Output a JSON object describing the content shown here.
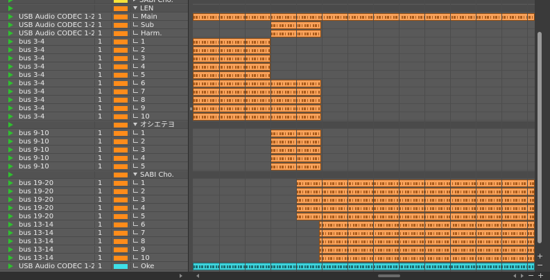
{
  "tracks": [
    {
      "input": "",
      "num": "",
      "color": "#f5e23a",
      "name": "SABI Cho.",
      "kind": "folder-collapsed"
    },
    {
      "input": "",
      "num": "",
      "color": "#ff8c1a",
      "name": "LEN",
      "kind": "folder"
    },
    {
      "input": "USB Audio CODEC  1-2",
      "num": "1",
      "color": "#ff8c1a",
      "name": "Main",
      "kind": "audio"
    },
    {
      "input": "USB Audio CODEC  1-2",
      "num": "1",
      "color": "#ff8c1a",
      "name": "Sub",
      "kind": "audio"
    },
    {
      "input": "USB Audio CODEC  1-2",
      "num": "1",
      "color": "#ff8c1a",
      "name": "Harm.",
      "kind": "audio"
    },
    {
      "input": "bus 3-4",
      "num": "1",
      "color": "#ff8c1a",
      "name": "1",
      "kind": "audio"
    },
    {
      "input": "bus 3-4",
      "num": "1",
      "color": "#ff8c1a",
      "name": "2",
      "kind": "audio"
    },
    {
      "input": "bus 3-4",
      "num": "1",
      "color": "#ff8c1a",
      "name": "3",
      "kind": "audio"
    },
    {
      "input": "bus 3-4",
      "num": "1",
      "color": "#ff8c1a",
      "name": "4",
      "kind": "audio"
    },
    {
      "input": "bus 3-4",
      "num": "1",
      "color": "#ff8c1a",
      "name": "5",
      "kind": "audio"
    },
    {
      "input": "bus 3-4",
      "num": "1",
      "color": "#ff8c1a",
      "name": "6",
      "kind": "audio"
    },
    {
      "input": "bus 3-4",
      "num": "1",
      "color": "#ff8c1a",
      "name": "7",
      "kind": "audio"
    },
    {
      "input": "bus 3-4",
      "num": "1",
      "color": "#ff8c1a",
      "name": "8",
      "kind": "audio"
    },
    {
      "input": "bus 3-4",
      "num": "1",
      "color": "#ff8c1a",
      "name": "9",
      "kind": "audio"
    },
    {
      "input": "bus 3-4",
      "num": "1",
      "color": "#ff8c1a",
      "name": "10",
      "kind": "audio"
    },
    {
      "input": "",
      "num": "",
      "color": "#ff8c1a",
      "name": "オシエテヨ",
      "kind": "folder"
    },
    {
      "input": "bus 9-10",
      "num": "1",
      "color": "#ff8c1a",
      "name": "1",
      "kind": "audio"
    },
    {
      "input": "bus 9-10",
      "num": "1",
      "color": "#ff8c1a",
      "name": "2",
      "kind": "audio"
    },
    {
      "input": "bus 9-10",
      "num": "1",
      "color": "#ff8c1a",
      "name": "3",
      "kind": "audio"
    },
    {
      "input": "bus 9-10",
      "num": "1",
      "color": "#ff8c1a",
      "name": "4",
      "kind": "audio"
    },
    {
      "input": "bus 9-10",
      "num": "1",
      "color": "#ff8c1a",
      "name": "5",
      "kind": "audio"
    },
    {
      "input": "",
      "num": "",
      "color": "#ff8c1a",
      "name": "SABI Cho.",
      "kind": "folder"
    },
    {
      "input": "bus 19-20",
      "num": "1",
      "color": "#ff8c1a",
      "name": "1",
      "kind": "audio"
    },
    {
      "input": "bus 19-20",
      "num": "1",
      "color": "#ff8c1a",
      "name": "2",
      "kind": "audio"
    },
    {
      "input": "bus 19-20",
      "num": "1",
      "color": "#ff8c1a",
      "name": "3",
      "kind": "audio"
    },
    {
      "input": "bus 19-20",
      "num": "1",
      "color": "#ff8c1a",
      "name": "4",
      "kind": "audio"
    },
    {
      "input": "bus 19-20",
      "num": "1",
      "color": "#ff8c1a",
      "name": "5",
      "kind": "audio"
    },
    {
      "input": "bus 13-14",
      "num": "1",
      "color": "#ff8c1a",
      "name": "6",
      "kind": "audio"
    },
    {
      "input": "bus 13-14",
      "num": "1",
      "color": "#ff8c1a",
      "name": "7",
      "kind": "audio"
    },
    {
      "input": "bus 13-14",
      "num": "1",
      "color": "#ff8c1a",
      "name": "8",
      "kind": "audio"
    },
    {
      "input": "bus 13-14",
      "num": "1",
      "color": "#ff8c1a",
      "name": "9",
      "kind": "audio"
    },
    {
      "input": "bus 13-14",
      "num": "1",
      "color": "#ff8c1a",
      "name": "10",
      "kind": "audio"
    },
    {
      "input": "USB Audio CODEC  1-2",
      "num": "1",
      "color": "#3ee0e8",
      "name": "Oke",
      "kind": "instrument"
    }
  ],
  "clips": [
    {
      "track": 2,
      "start": 0.0,
      "end": 1.0,
      "color": "orange"
    },
    {
      "track": 3,
      "start": 0.227,
      "end": 0.376,
      "color": "orange"
    },
    {
      "track": 4,
      "start": 0.227,
      "end": 0.376,
      "color": "orange"
    },
    {
      "track": 5,
      "start": 0.0,
      "end": 0.227,
      "color": "orange"
    },
    {
      "track": 6,
      "start": 0.0,
      "end": 0.227,
      "color": "orange"
    },
    {
      "track": 7,
      "start": 0.0,
      "end": 0.227,
      "color": "orange"
    },
    {
      "track": 8,
      "start": 0.0,
      "end": 0.227,
      "color": "orange"
    },
    {
      "track": 9,
      "start": 0.0,
      "end": 0.227,
      "color": "orange"
    },
    {
      "track": 10,
      "start": 0.0,
      "end": 0.376,
      "color": "orange"
    },
    {
      "track": 11,
      "start": 0.0,
      "end": 0.376,
      "color": "orange"
    },
    {
      "track": 12,
      "start": 0.0,
      "end": 0.376,
      "color": "orange"
    },
    {
      "track": 13,
      "start": 0.0,
      "end": 0.376,
      "color": "orange"
    },
    {
      "track": 14,
      "start": 0.0,
      "end": 0.376,
      "color": "orange"
    },
    {
      "track": 16,
      "start": 0.227,
      "end": 0.376,
      "color": "orange"
    },
    {
      "track": 17,
      "start": 0.227,
      "end": 0.376,
      "color": "orange"
    },
    {
      "track": 18,
      "start": 0.227,
      "end": 0.376,
      "color": "orange"
    },
    {
      "track": 19,
      "start": 0.227,
      "end": 0.376,
      "color": "orange"
    },
    {
      "track": 20,
      "start": 0.227,
      "end": 0.376,
      "color": "orange"
    },
    {
      "track": 22,
      "start": 0.302,
      "end": 1.0,
      "color": "orange"
    },
    {
      "track": 23,
      "start": 0.302,
      "end": 1.0,
      "color": "orange"
    },
    {
      "track": 24,
      "start": 0.302,
      "end": 1.0,
      "color": "orange"
    },
    {
      "track": 25,
      "start": 0.302,
      "end": 1.0,
      "color": "orange"
    },
    {
      "track": 26,
      "start": 0.302,
      "end": 1.0,
      "color": "orange"
    },
    {
      "track": 27,
      "start": 0.37,
      "end": 1.0,
      "color": "orange"
    },
    {
      "track": 28,
      "start": 0.37,
      "end": 1.0,
      "color": "orange"
    },
    {
      "track": 29,
      "start": 0.37,
      "end": 1.0,
      "color": "orange"
    },
    {
      "track": 30,
      "start": 0.37,
      "end": 1.0,
      "color": "orange"
    },
    {
      "track": 31,
      "start": 0.37,
      "end": 1.0,
      "color": "orange"
    },
    {
      "track": 32,
      "start": 0.0,
      "end": 1.0,
      "color": "cyan"
    }
  ],
  "playhead_position": 0.302,
  "vertical_zoom": {
    "in_label": "+",
    "out_label": "−"
  },
  "horizontal_zoom": {
    "in_label": "+",
    "out_label": "−"
  },
  "icons": {
    "monitor": "play-icon",
    "folder_open": "folder-expand-icon",
    "track": "track-line-icon",
    "instrument": "instrument-icon"
  }
}
